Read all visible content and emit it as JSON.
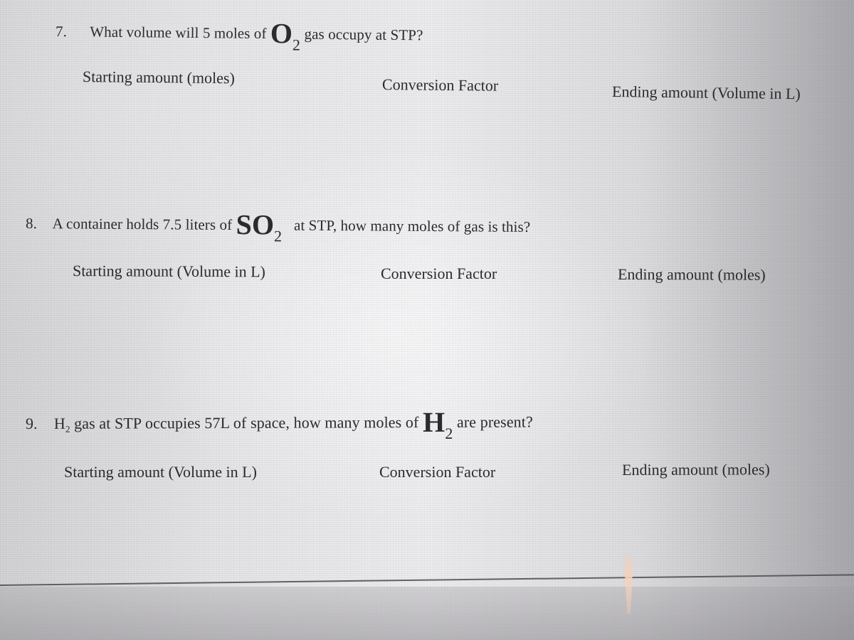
{
  "questions": [
    {
      "number": "7.",
      "text_before": "What volume will 5 moles of",
      "formula_element": "O",
      "formula_subscript": "2",
      "text_after": "gas occupy at STP?",
      "columns": {
        "start": "Starting amount (moles)",
        "conversion": "Conversion Factor",
        "end": "Ending amount (Volume in L)"
      }
    },
    {
      "number": "8.",
      "text_before": "A container holds 7.5 liters of",
      "formula_element": "SO",
      "formula_subscript": "2",
      "text_after": "at STP, how many moles of gas is this?",
      "columns": {
        "start": "Starting amount (Volume in L)",
        "conversion": "Conversion Factor",
        "end": "Ending amount (moles)"
      }
    },
    {
      "number": "9.",
      "inline_element": "H",
      "inline_subscript": "2",
      "text_before": "gas at STP occupies 57L of space, how many moles of",
      "formula_element": "H",
      "formula_subscript": "2",
      "text_after": "are present?",
      "columns": {
        "start": "Starting amount (Volume in L)",
        "conversion": "Conversion Factor",
        "end": "Ending amount (moles)"
      }
    }
  ]
}
